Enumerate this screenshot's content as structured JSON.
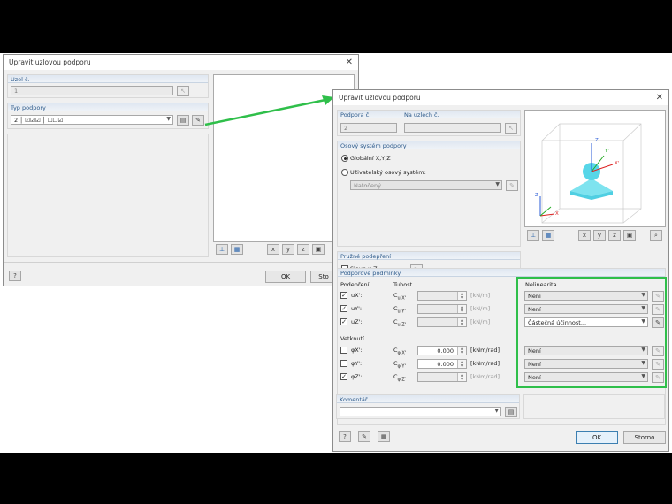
{
  "back_dialog": {
    "title": "Upravit uzlovou podporu",
    "node_label": "Uzel č.",
    "node_value": "1",
    "type_label": "Typ podpory",
    "type_value": "2 │ ☑☑☑ │ ☐☐☑",
    "ok": "OK",
    "cancel": "Sto"
  },
  "front_dialog": {
    "title": "Upravit uzlovou podporu",
    "support_no_label": "Podpora č.",
    "support_no_value": "2",
    "nodes_label": "Na uzlech č.",
    "nodes_value": "",
    "axis_group": "Osový systém podpory",
    "axis_global": "Globální X,Y,Z",
    "axis_user": "Uživatelský osový systém:",
    "axis_user_value": "Natočený",
    "elastic_group": "Pružné podepření",
    "column_label": "Sloup v Z...",
    "conditions_group": "Podporové podmínky",
    "support_col": "Podepření",
    "stiffness_col": "Tuhost",
    "nonlinearity_col": "Nelinearita",
    "restraint_col": "Vetknutí",
    "rows_support": [
      {
        "label": "uX':",
        "sym": "C",
        "sub": "u,X'",
        "value": "",
        "unit": "[kN/m]",
        "checked": true,
        "nl": "Není"
      },
      {
        "label": "uY':",
        "sym": "C",
        "sub": "u,Y'",
        "value": "",
        "unit": "[kN/m]",
        "checked": true,
        "nl": "Není"
      },
      {
        "label": "uZ':",
        "sym": "C",
        "sub": "u,Z'",
        "value": "",
        "unit": "[kN/m]",
        "checked": true,
        "nl": "Částečná účinnost..."
      }
    ],
    "rows_restraint": [
      {
        "label": "φX':",
        "sym": "C",
        "sub": "φ,X'",
        "value": "0.000",
        "unit": "[kNm/rad]",
        "checked": false,
        "nl": "Není"
      },
      {
        "label": "φY':",
        "sym": "C",
        "sub": "φ,Y'",
        "value": "0.000",
        "unit": "[kNm/rad]",
        "checked": false,
        "nl": "Není"
      },
      {
        "label": "φZ':",
        "sym": "C",
        "sub": "φ,Z'",
        "value": "",
        "unit": "[kNm/rad]",
        "checked": true,
        "nl": "Není"
      }
    ],
    "comment_label": "Komentář",
    "comment_value": "",
    "ok": "OK",
    "cancel": "Storno",
    "axes": {
      "x": "X'",
      "y": "Y'",
      "z": "Z'",
      "X": "X",
      "Z": "Z"
    }
  },
  "colors": {
    "highlight": "#2fbf4a",
    "support_body": "#57d6e8",
    "support_base": "#7ee3ef"
  }
}
